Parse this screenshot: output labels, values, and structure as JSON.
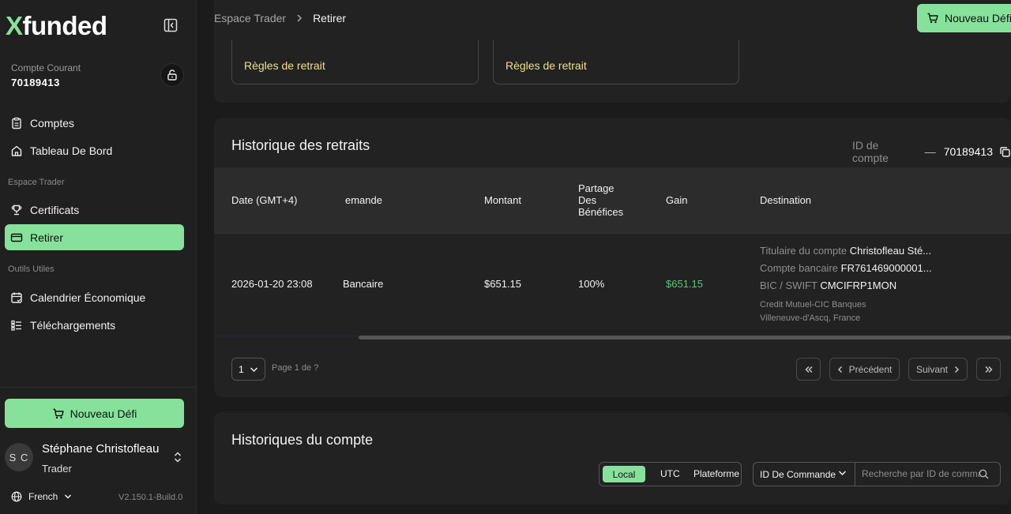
{
  "app": {
    "logo_x": "X",
    "logo_rest": "funded",
    "version": "V2.150.1-Build.0"
  },
  "sidebar": {
    "account_label": "Compte Courant",
    "account_number": "70189413",
    "items_main": [
      {
        "label": "Comptes",
        "icon": "clipboard-icon"
      },
      {
        "label": "Tableau De Bord",
        "icon": "home-icon"
      }
    ],
    "section_trader": "Espace Trader",
    "items_trader": [
      {
        "label": "Certificats",
        "icon": "trophy-icon"
      },
      {
        "label": "Retirer",
        "icon": "card-icon"
      }
    ],
    "section_tools": "Outils Utiles",
    "items_tools": [
      {
        "label": "Calendrier Économique",
        "icon": "calendar-icon"
      },
      {
        "label": "Téléchargements",
        "icon": "list-icon"
      }
    ],
    "new_challenge": "Nouveau Défi",
    "user": {
      "initials": "S C",
      "name": "Stéphane Christofleau",
      "role": "Trader"
    },
    "language": "French"
  },
  "topbar": {
    "breadcrumb": [
      "Espace Trader",
      "Retirer"
    ],
    "new_challenge": "Nouveau Défi"
  },
  "rules": {
    "link1": "Règles de retrait",
    "link2": "Règles de retrait"
  },
  "history": {
    "title": "Historique des retraits",
    "account_id_label": "ID de compte",
    "account_id_dash": "—",
    "account_id_value": "70189413",
    "columns": {
      "date": "Date (GMT+4)",
      "request": "emande",
      "amount": "Montant",
      "share": "Partage\nDes\nBénéfices",
      "gain": "Gain",
      "destination": "Destination"
    },
    "row": {
      "date": "2026-01-20 23:08",
      "request": "Bancaire",
      "amount": "$651.15",
      "share": "100%",
      "gain": "$651.15",
      "holder_label": "Titulaire du compte",
      "holder_value": "Christofleau Sté...",
      "iban_label": "Compte bancaire",
      "iban_value": "FR761469000001...",
      "bic_label": "BIC / SWIFT",
      "bic_value": "CMCIFRP1MON",
      "bank_name": "Credit Mutuel-CIC Banques",
      "bank_city": "Villeneuve-d'Ascq, France"
    },
    "pagination": {
      "page_value": "1",
      "page_info": "Page 1 de ?",
      "prev": "Précédent",
      "next": "Suivant"
    }
  },
  "account_history": {
    "title": "Historiques du compte",
    "timezone_options": [
      "Local",
      "UTC",
      "Plateforme"
    ],
    "timezone_selected": "Local",
    "filter_select": "ID De Commande",
    "search_placeholder": "Recherche par ID de commande"
  },
  "colors": {
    "accent": "#86e29b",
    "gain": "#5fc678",
    "rule_link": "#efe08f"
  }
}
